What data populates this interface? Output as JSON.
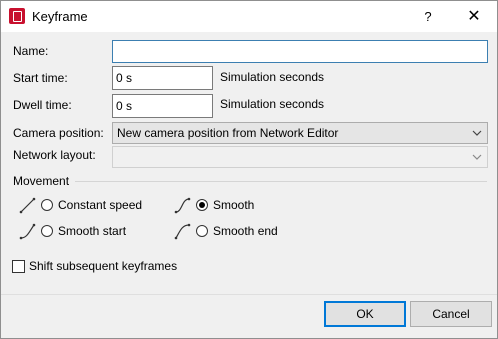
{
  "window": {
    "title": "Keyframe",
    "help_label": "?",
    "close_label": "✕"
  },
  "fields": {
    "name_label": "Name:",
    "name_value": "",
    "start_time_label": "Start time:",
    "start_time_value": "0 s",
    "start_time_unit": "Simulation seconds",
    "dwell_time_label": "Dwell time:",
    "dwell_time_value": "0 s",
    "dwell_time_unit": "Simulation seconds",
    "camera_label": "Camera position:",
    "camera_value": "New camera position from Network Editor",
    "network_label": "Network layout:",
    "network_value": ""
  },
  "movement": {
    "label": "Movement",
    "options": [
      {
        "label": "Constant speed",
        "checked": false,
        "icon": "curve-linear-icon"
      },
      {
        "label": "Smooth",
        "checked": true,
        "icon": "curve-smooth-icon"
      },
      {
        "label": "Smooth start",
        "checked": false,
        "icon": "curve-ease-in-icon"
      },
      {
        "label": "Smooth end",
        "checked": false,
        "icon": "curve-ease-out-icon"
      }
    ]
  },
  "shift": {
    "label": "Shift subsequent keyframes",
    "checked": false
  },
  "buttons": {
    "ok": "OK",
    "cancel": "Cancel"
  }
}
